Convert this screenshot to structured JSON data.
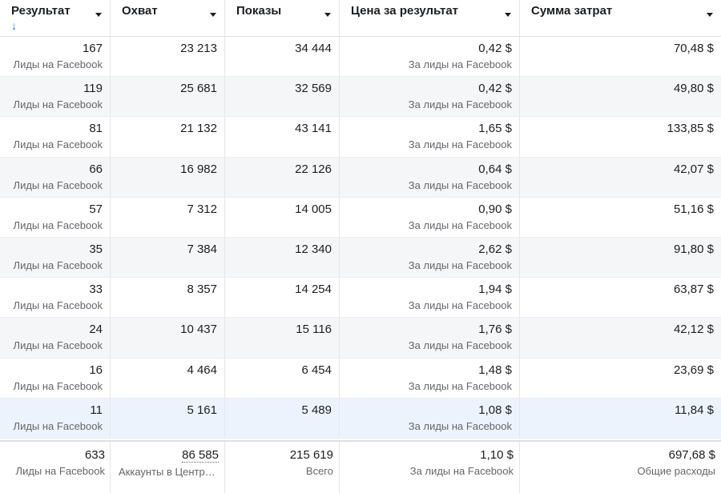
{
  "columns": [
    {
      "label": "Результат",
      "sort_icon": "↓"
    },
    {
      "label": "Охват"
    },
    {
      "label": "Показы"
    },
    {
      "label": "Цена за результат"
    },
    {
      "label": "Сумма затрат"
    }
  ],
  "rows": [
    {
      "result": "167",
      "result_sub": "Лиды на Facebook",
      "reach": "23 213",
      "impressions": "34 444",
      "cpr": "0,42 $",
      "cpr_sub": "За лиды на Facebook",
      "spend": "70,48 $"
    },
    {
      "result": "119",
      "result_sub": "Лиды на Facebook",
      "reach": "25 681",
      "impressions": "32 569",
      "cpr": "0,42 $",
      "cpr_sub": "За лиды на Facebook",
      "spend": "49,80 $"
    },
    {
      "result": "81",
      "result_sub": "Лиды на Facebook",
      "reach": "21 132",
      "impressions": "43 141",
      "cpr": "1,65 $",
      "cpr_sub": "За лиды на Facebook",
      "spend": "133,85 $"
    },
    {
      "result": "66",
      "result_sub": "Лиды на Facebook",
      "reach": "16 982",
      "impressions": "22 126",
      "cpr": "0,64 $",
      "cpr_sub": "За лиды на Facebook",
      "spend": "42,07 $"
    },
    {
      "result": "57",
      "result_sub": "Лиды на Facebook",
      "reach": "7 312",
      "impressions": "14 005",
      "cpr": "0,90 $",
      "cpr_sub": "За лиды на Facebook",
      "spend": "51,16 $"
    },
    {
      "result": "35",
      "result_sub": "Лиды на Facebook",
      "reach": "7 384",
      "impressions": "12 340",
      "cpr": "2,62 $",
      "cpr_sub": "За лиды на Facebook",
      "spend": "91,80 $"
    },
    {
      "result": "33",
      "result_sub": "Лиды на Facebook",
      "reach": "8 357",
      "impressions": "14 254",
      "cpr": "1,94 $",
      "cpr_sub": "За лиды на Facebook",
      "spend": "63,87 $"
    },
    {
      "result": "24",
      "result_sub": "Лиды на Facebook",
      "reach": "10 437",
      "impressions": "15 116",
      "cpr": "1,76 $",
      "cpr_sub": "За лиды на Facebook",
      "spend": "42,12 $"
    },
    {
      "result": "16",
      "result_sub": "Лиды на Facebook",
      "reach": "4 464",
      "impressions": "6 454",
      "cpr": "1,48 $",
      "cpr_sub": "За лиды на Facebook",
      "spend": "23,69 $"
    },
    {
      "result": "11",
      "result_sub": "Лиды на Facebook",
      "reach": "5 161",
      "impressions": "5 489",
      "cpr": "1,08 $",
      "cpr_sub": "За лиды на Facebook",
      "spend": "11,84 $",
      "highlighted": true
    }
  ],
  "totals": {
    "result": "633",
    "result_sub": "Лиды на Facebook",
    "reach": "86 585",
    "reach_sub": "Аккаунты в Центр…",
    "impressions": "215 619",
    "impressions_sub": "Всего",
    "cpr": "1,10 $",
    "cpr_sub": "За лиды на Facebook",
    "spend": "697,68 $",
    "spend_sub": "Общие расходы"
  }
}
